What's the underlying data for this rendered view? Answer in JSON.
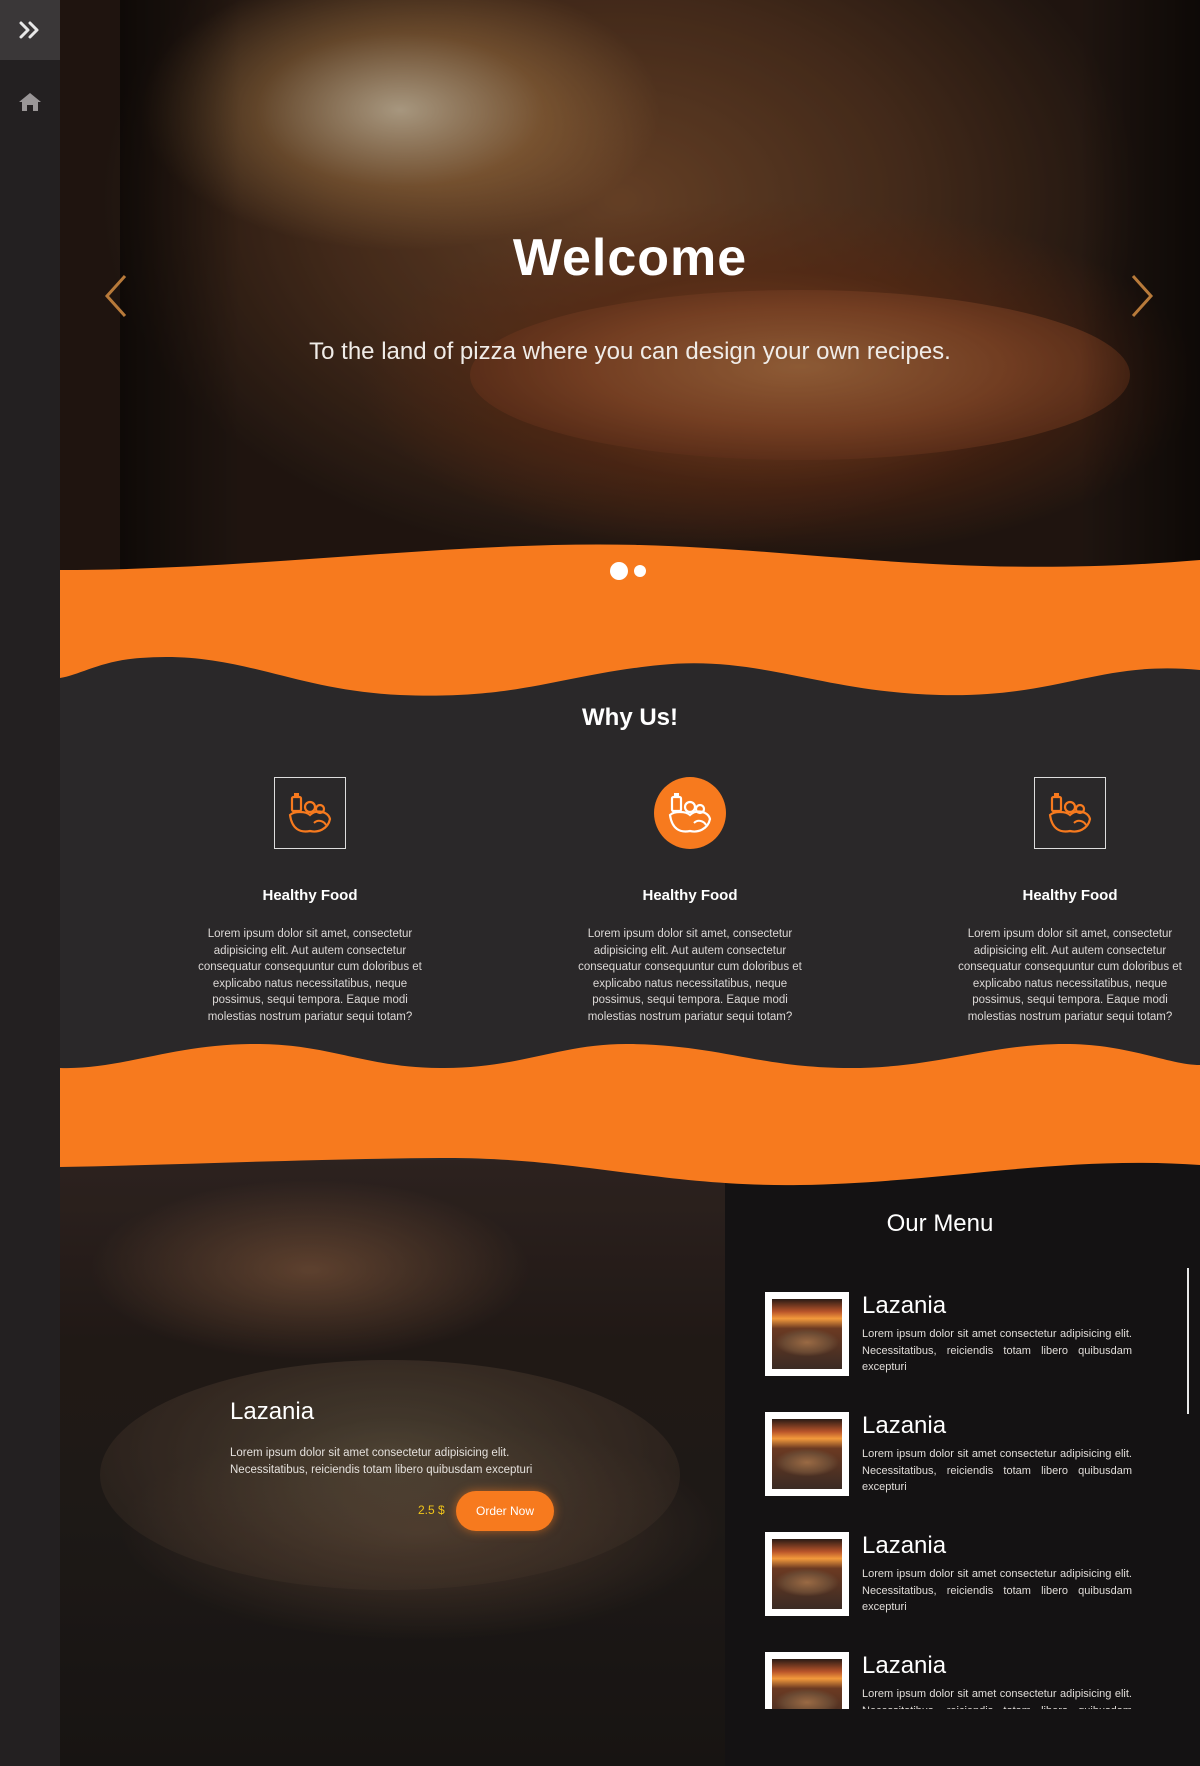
{
  "hero": {
    "title": "Welcome",
    "subtitle": "To the land of pizza where you can design your own recipes."
  },
  "why": {
    "title": "Why Us!",
    "features": [
      {
        "icon": "food-icon",
        "style": "boxed",
        "title": "Healthy Food",
        "text": "Lorem ipsum dolor sit amet, consectetur adipisicing elit. Aut autem consectetur consequatur consequuntur cum doloribus et explicabo natus necessitatibus, neque possimus, sequi tempora. Eaque modi molestias nostrum pariatur sequi totam?"
      },
      {
        "icon": "food-icon",
        "style": "round",
        "title": "Healthy Food",
        "text": "Lorem ipsum dolor sit amet, consectetur adipisicing elit. Aut autem consectetur consequatur consequuntur cum doloribus et explicabo natus necessitatibus, neque possimus, sequi tempora. Eaque modi molestias nostrum pariatur sequi totam?"
      },
      {
        "icon": "food-icon",
        "style": "boxed",
        "title": "Healthy Food",
        "text": "Lorem ipsum dolor sit amet, consectetur adipisicing elit. Aut autem consectetur consequatur consequuntur cum doloribus et explicabo natus necessitatibus, neque possimus, sequi tempora. Eaque modi molestias nostrum pariatur sequi totam?"
      }
    ]
  },
  "featured": {
    "name": "Lazania",
    "description": "Lorem ipsum dolor sit amet consectetur adipisicing elit. Necessitatibus, reiciendis totam libero quibusdam excepturi",
    "price": "2.5 $",
    "order_label": "Order Now"
  },
  "menu": {
    "title": "Our Menu",
    "items": [
      {
        "name": "Lazania",
        "description": "Lorem ipsum dolor sit amet consectetur adipisicing elit. Necessitatibus, reiciendis totam libero quibusdam excepturi"
      },
      {
        "name": "Lazania",
        "description": "Lorem ipsum dolor sit amet consectetur adipisicing elit. Necessitatibus, reiciendis totam libero quibusdam excepturi"
      },
      {
        "name": "Lazania",
        "description": "Lorem ipsum dolor sit amet consectetur adipisicing elit. Necessitatibus, reiciendis totam libero quibusdam excepturi"
      },
      {
        "name": "Lazania",
        "description": "Lorem ipsum dolor sit amet consectetur adipisicing elit. Necessitatibus, reiciendis totam libero quibusdam excepturi"
      }
    ]
  },
  "colors": {
    "accent": "#f77a1e",
    "dark": "#2a2829",
    "sidebar": "#232021"
  },
  "icons": {
    "sidebar_toggle": "double-chevron-right-icon",
    "home": "home-icon",
    "prev": "chevron-left-icon",
    "next": "chevron-right-icon"
  }
}
